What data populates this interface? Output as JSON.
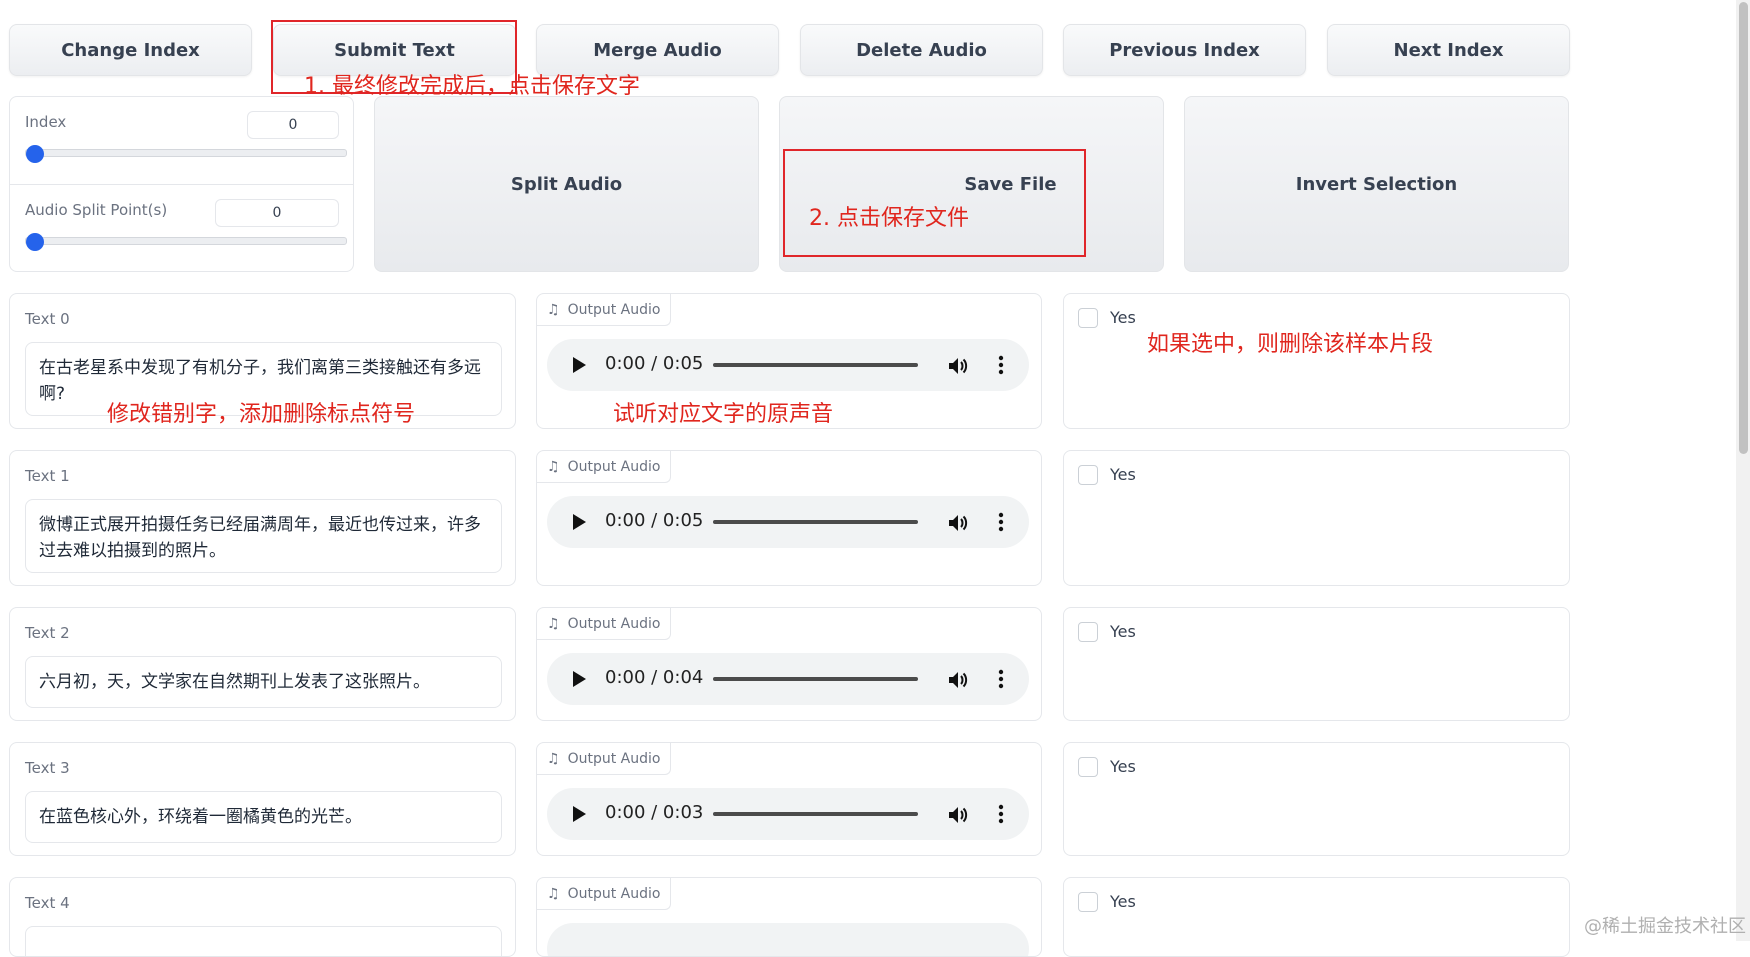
{
  "toolbar": {
    "change_index": "Change Index",
    "submit_text": "Submit Text",
    "merge_audio": "Merge Audio",
    "delete_audio": "Delete Audio",
    "previous_index": "Previous Index",
    "next_index": "Next Index"
  },
  "controls": {
    "index_label": "Index",
    "index_value": "0",
    "split_label": "Audio Split Point(s)",
    "split_value": "0",
    "split_audio": "Split Audio",
    "save_file": "Save File",
    "invert_selection": "Invert Selection"
  },
  "rows": [
    {
      "label": "Text 0",
      "text": "在古老星系中发现了有机分子，我们离第三类接触还有多远啊?",
      "audio_label": "Output Audio",
      "time": "0:00 / 0:05",
      "checkbox_label": "Yes"
    },
    {
      "label": "Text 1",
      "text": "微博正式展开拍摄任务已经届满周年，最近也传过来，许多过去难以拍摄到的照片。",
      "audio_label": "Output Audio",
      "time": "0:00 / 0:05",
      "checkbox_label": "Yes"
    },
    {
      "label": "Text 2",
      "text": "六月初，天，文学家在自然期刊上发表了这张照片。",
      "audio_label": "Output Audio",
      "time": "0:00 / 0:04",
      "checkbox_label": "Yes"
    },
    {
      "label": "Text 3",
      "text": "在蓝色核心外，环绕着一圈橘黄色的光芒。",
      "audio_label": "Output Audio",
      "time": "0:00 / 0:03",
      "checkbox_label": "Yes"
    },
    {
      "label": "Text 4",
      "text": "",
      "audio_label": "Output Audio",
      "time": "",
      "checkbox_label": "Yes"
    }
  ],
  "annotations": {
    "step1": "1. 最终修改完成后，点击保存文字",
    "step2": "2. 点击保存文件",
    "edit_hint": "修改错别字，添加删除标点符号",
    "listen_hint": "试听对应文字的原声音",
    "delete_hint": "如果选中，则删除该样本片段"
  },
  "watermark": "@稀土掘金技术社区",
  "colors": {
    "accent": "#2563eb",
    "annotation_red": "#e0261e"
  }
}
